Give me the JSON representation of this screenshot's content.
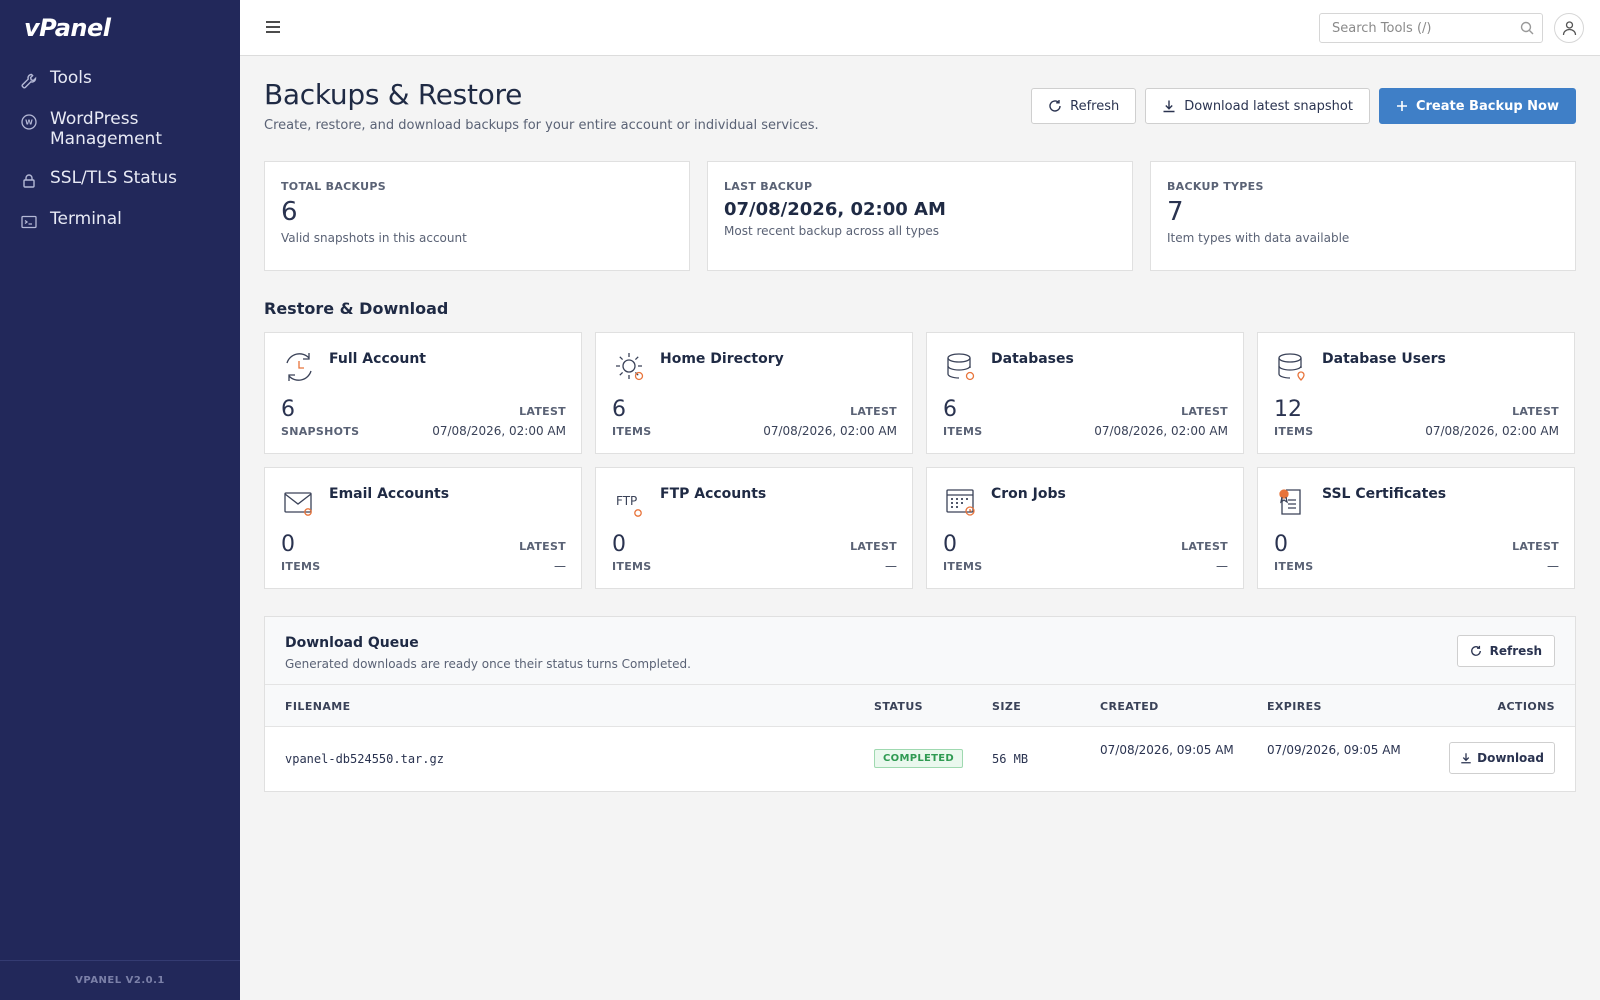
{
  "app": {
    "logo": "vPanel",
    "version": "VPANEL V2.0.1",
    "accent": "#3f7fc7",
    "sidebar_bg": "#22285a"
  },
  "sidebar": {
    "items": [
      {
        "label": "Tools",
        "icon": "wrench-icon"
      },
      {
        "label": "WordPress Management",
        "icon": "wordpress-icon"
      },
      {
        "label": "SSL/TLS Status",
        "icon": "lock-icon"
      },
      {
        "label": "Terminal",
        "icon": "terminal-icon"
      }
    ]
  },
  "topbar": {
    "search_placeholder": "Search Tools (/)"
  },
  "page": {
    "title": "Backups & Restore",
    "subtitle": "Create, restore, and download backups for your entire account or individual services.",
    "actions": {
      "refresh": "Refresh",
      "download_snapshot": "Download latest snapshot",
      "create_backup": "Create Backup Now"
    }
  },
  "stats": [
    {
      "key": "TOTAL BACKUPS",
      "value": "6",
      "desc": "Valid snapshots in this account"
    },
    {
      "key": "LAST BACKUP",
      "value": "07/08/2026, 02:00 AM",
      "desc": "Most recent backup across all types"
    },
    {
      "key": "BACKUP TYPES",
      "value": "7",
      "desc": "Item types with data available"
    }
  ],
  "restore": {
    "title": "Restore & Download",
    "cards": [
      {
        "title": "Full Account",
        "count": "6",
        "unit": "SNAPSHOTS",
        "latest_label": "LATEST",
        "latest": "07/08/2026, 02:00 AM",
        "icon": "full-account-icon"
      },
      {
        "title": "Home Directory",
        "count": "6",
        "unit": "ITEMS",
        "latest_label": "LATEST",
        "latest": "07/08/2026, 02:00 AM",
        "icon": "home-directory-icon"
      },
      {
        "title": "Databases",
        "count": "6",
        "unit": "ITEMS",
        "latest_label": "LATEST",
        "latest": "07/08/2026, 02:00 AM",
        "icon": "database-icon"
      },
      {
        "title": "Database Users",
        "count": "12",
        "unit": "ITEMS",
        "latest_label": "LATEST",
        "latest": "07/08/2026, 02:00 AM",
        "icon": "database-users-icon"
      },
      {
        "title": "Email Accounts",
        "count": "0",
        "unit": "ITEMS",
        "latest_label": "LATEST",
        "latest": "—",
        "icon": "email-icon"
      },
      {
        "title": "FTP Accounts",
        "count": "0",
        "unit": "ITEMS",
        "latest_label": "LATEST",
        "latest": "—",
        "icon": "ftp-icon"
      },
      {
        "title": "Cron Jobs",
        "count": "0",
        "unit": "ITEMS",
        "latest_label": "LATEST",
        "latest": "—",
        "icon": "cron-icon"
      },
      {
        "title": "SSL Certificates",
        "count": "0",
        "unit": "ITEMS",
        "latest_label": "LATEST",
        "latest": "—",
        "icon": "certificate-icon"
      }
    ]
  },
  "queue": {
    "title": "Download Queue",
    "subtitle": "Generated downloads are ready once their status turns Completed.",
    "refresh": "Refresh",
    "ftp_text": "FTP",
    "columns": [
      "FILENAME",
      "STATUS",
      "SIZE",
      "CREATED",
      "EXPIRES",
      "ACTIONS"
    ],
    "rows": [
      {
        "filename": "vpanel-db524550.tar.gz",
        "status": "COMPLETED",
        "size": "56 MB",
        "created": "07/08/2026, 09:05 AM",
        "expires": "07/09/2026, 09:05 AM",
        "action": "Download"
      }
    ]
  }
}
